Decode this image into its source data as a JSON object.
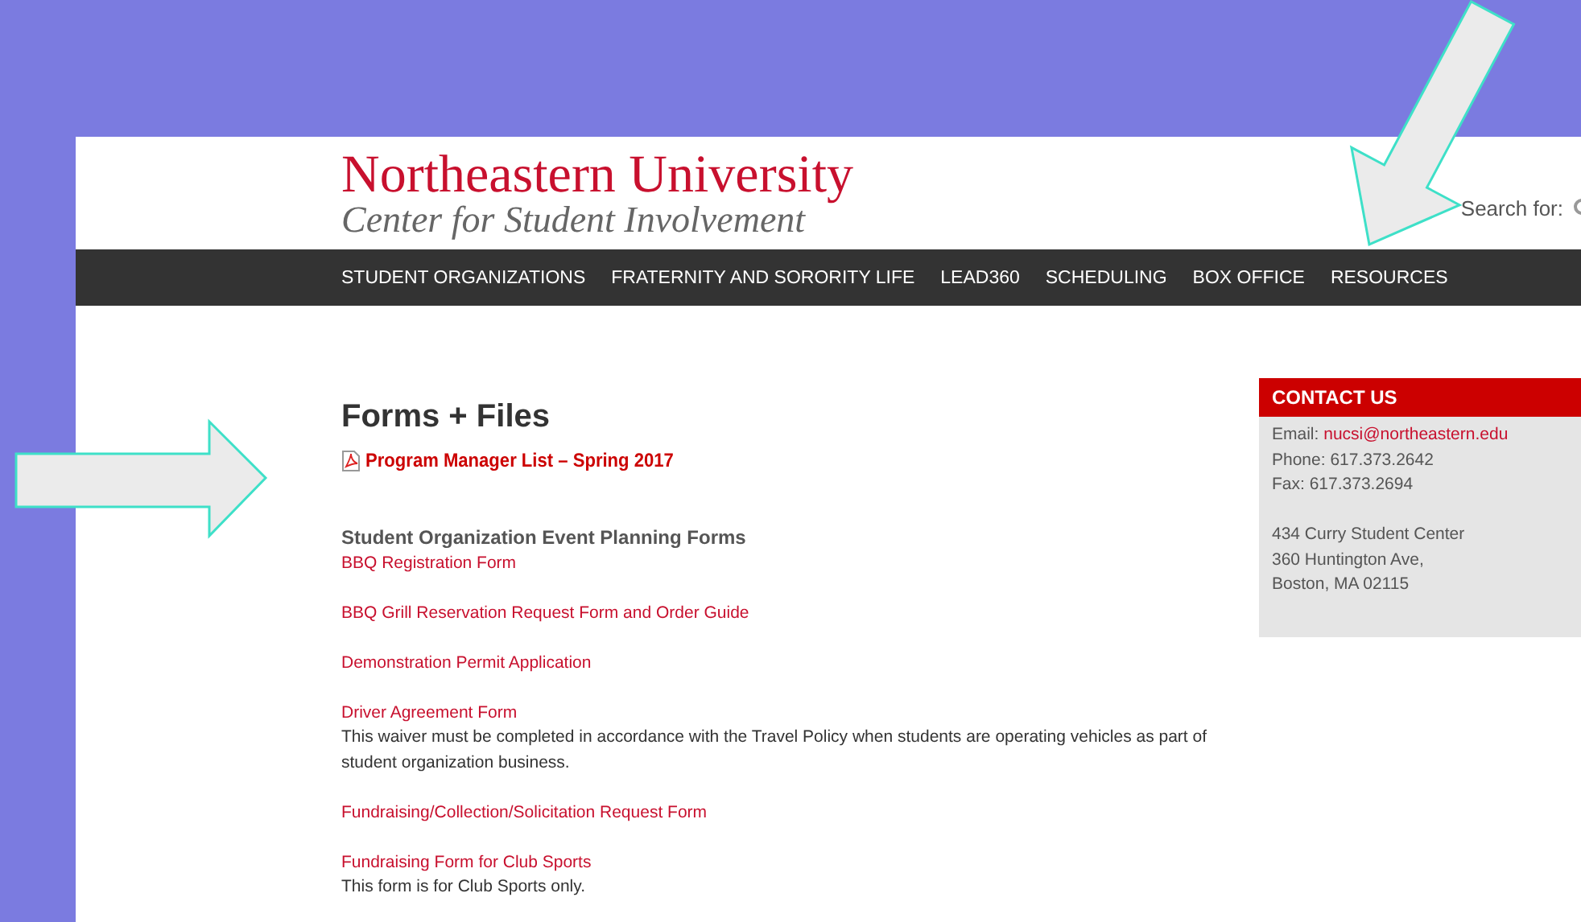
{
  "header": {
    "logo_title": "Northeastern University",
    "logo_subtitle": "Center for Student Involvement",
    "search_label": "Search for:"
  },
  "nav": {
    "items": [
      "STUDENT ORGANIZATIONS",
      "FRATERNITY AND SORORITY LIFE",
      "LEAD360",
      "SCHEDULING",
      "BOX OFFICE",
      "RESOURCES"
    ]
  },
  "page_title": "Forms + Files",
  "featured_file": {
    "label": "Program Manager List – Spring 2017"
  },
  "section": {
    "heading": "Student Organization Event Planning Forms",
    "items": [
      {
        "label": "BBQ Registration Form"
      },
      {
        "label": "BBQ Grill Reservation Request Form and Order Guide"
      },
      {
        "label": "Demonstration Permit Application"
      },
      {
        "label": "Driver Agreement Form",
        "description": "This waiver must be completed in accordance with the Travel Policy when students are operating vehicles as part of student organization business."
      },
      {
        "label": "Fundraising/Collection/Solicitation Request Form"
      },
      {
        "label": "Fundraising Form for Club Sports",
        "description": "This form is for Club Sports only."
      }
    ]
  },
  "sidebar": {
    "heading": "CONTACT US",
    "email_label": "Email:",
    "email": "nucsi@northeastern.edu",
    "lines": [
      "Phone: 617.373.2642",
      "Fax: 617.373.2694"
    ],
    "address": [
      "434 Curry Student Center",
      "360 Huntington Ave,",
      "Boston, MA 02115"
    ]
  }
}
